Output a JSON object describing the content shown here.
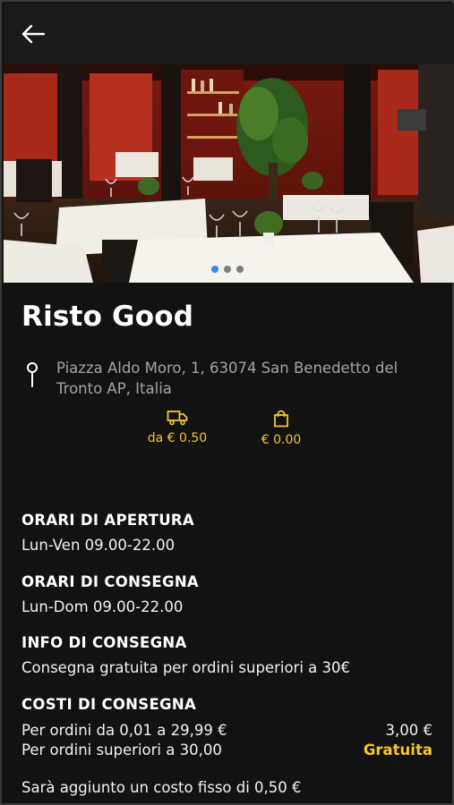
{
  "restaurant": {
    "name": "Risto Good",
    "address": "Piazza Aldo Moro, 1, 63074 San Benedetto del Tronto AP, Italia"
  },
  "icons": {
    "back": "arrow-left-icon",
    "location": "location-pin-icon",
    "delivery": "delivery-truck-icon",
    "bag": "shopping-bag-icon"
  },
  "stats": {
    "delivery_cost": "da € 0.50",
    "min_order": "€ 0.00"
  },
  "carousel": {
    "slides": 3,
    "active_index": 0
  },
  "sections": {
    "opening_title": "ORARI DI APERTURA",
    "opening_value": "Lun-Ven 09.00-22.00",
    "delivery_hours_title": "ORARI DI CONSEGNA",
    "delivery_hours_value": "Lun-Dom 09.00-22.00",
    "delivery_info_title": "INFO DI CONSEGNA",
    "delivery_info_value": "Consegna gratuita per ordini superiori a 30€",
    "delivery_costs_title": "COSTI DI CONSEGNA",
    "cost_rows": [
      {
        "label": "Per ordini da 0,01 a 29,99 €",
        "value": "3,00 €"
      },
      {
        "label": "Per ordini superiori a 30,00",
        "value": "Gratuita"
      }
    ],
    "fixed_fee_note": "Sarà aggiunto un costo fisso di 0,50 €"
  },
  "colors": {
    "accent": "#f4c430",
    "background": "#121212",
    "active_dot": "#2f8ee5"
  }
}
